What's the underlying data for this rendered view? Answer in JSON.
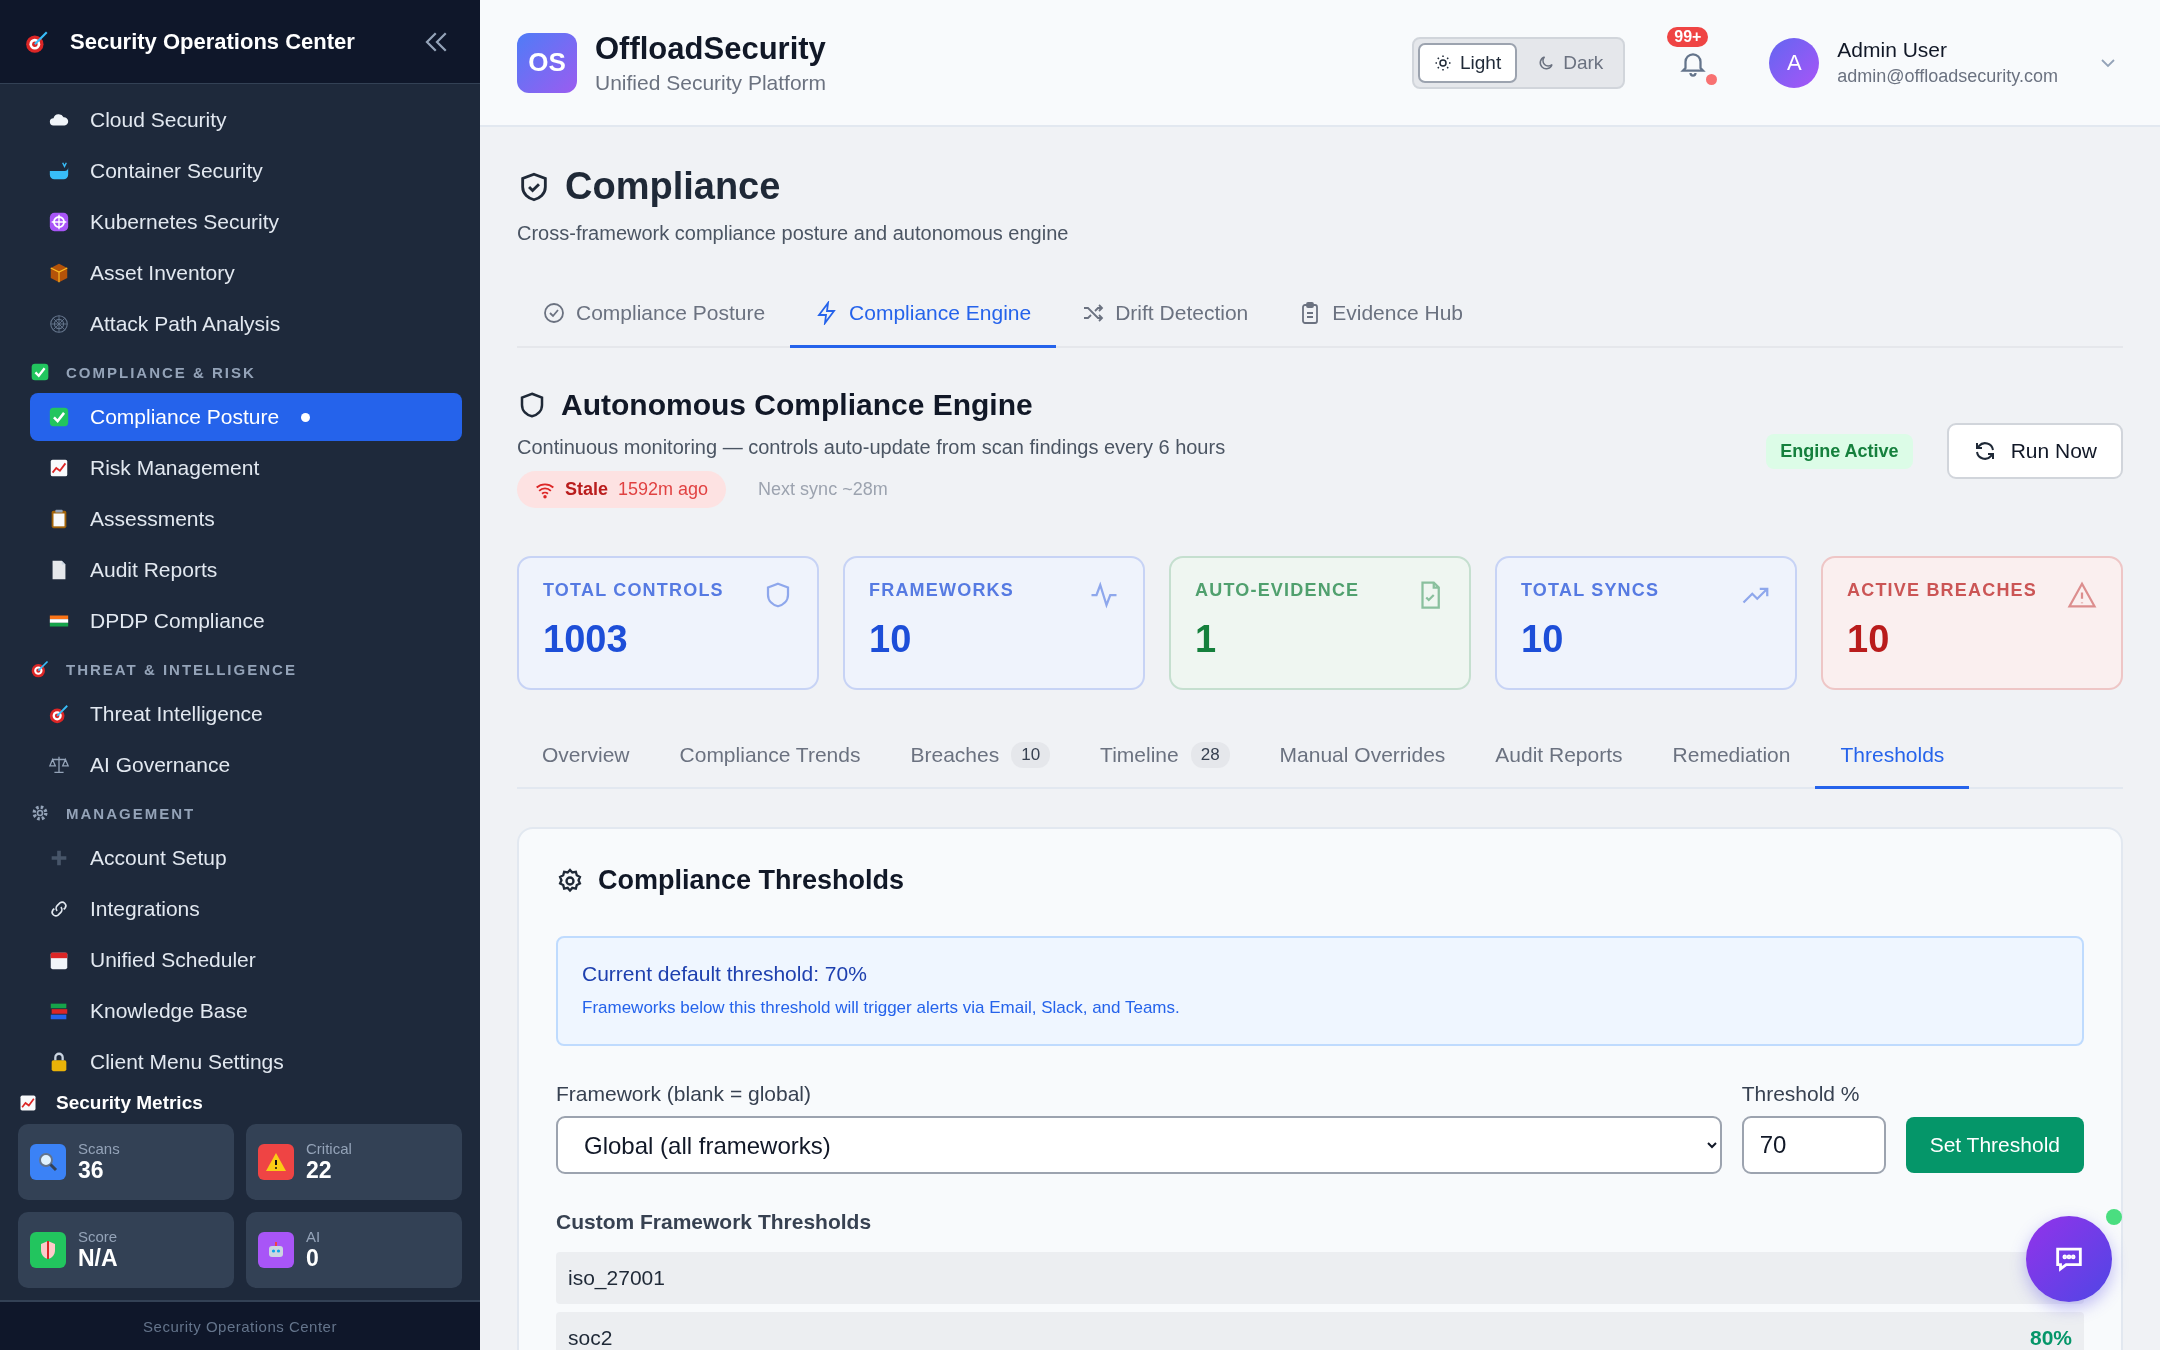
{
  "sidebar": {
    "title": "Security Operations Center",
    "nav": [
      {
        "kind": "item",
        "label": "Cloud Security",
        "selected": false
      },
      {
        "kind": "item",
        "label": "Container Security",
        "selected": false
      },
      {
        "kind": "item",
        "label": "Kubernetes Security",
        "selected": false
      },
      {
        "kind": "item",
        "label": "Asset Inventory",
        "selected": false
      },
      {
        "kind": "item",
        "label": "Attack Path Analysis",
        "selected": false
      },
      {
        "kind": "section",
        "label": "COMPLIANCE & RISK"
      },
      {
        "kind": "item",
        "label": "Compliance Posture",
        "selected": true
      },
      {
        "kind": "item",
        "label": "Risk Management",
        "selected": false
      },
      {
        "kind": "item",
        "label": "Assessments",
        "selected": false
      },
      {
        "kind": "item",
        "label": "Audit Reports",
        "selected": false
      },
      {
        "kind": "item",
        "label": "DPDP Compliance",
        "selected": false
      },
      {
        "kind": "section",
        "label": "THREAT & INTELLIGENCE"
      },
      {
        "kind": "item",
        "label": "Threat Intelligence",
        "selected": false
      },
      {
        "kind": "item",
        "label": "AI Governance",
        "selected": false
      },
      {
        "kind": "section",
        "label": "MANAGEMENT"
      },
      {
        "kind": "item",
        "label": "Account Setup",
        "selected": false
      },
      {
        "kind": "item",
        "label": "Integrations",
        "selected": false
      },
      {
        "kind": "item",
        "label": "Unified Scheduler",
        "selected": false
      },
      {
        "kind": "item",
        "label": "Knowledge Base",
        "selected": false
      },
      {
        "kind": "item",
        "label": "Client Menu Settings",
        "selected": false
      }
    ],
    "metrics_title": "Security Metrics",
    "metrics": [
      {
        "label": "Scans",
        "value": "36",
        "color": "#3b82f6"
      },
      {
        "label": "Critical",
        "value": "22",
        "color": "#ef4444"
      },
      {
        "label": "Score",
        "value": "N/A",
        "color": "#22c55e"
      },
      {
        "label": "AI",
        "value": "0",
        "color": "#a855f7"
      }
    ],
    "footer": "Security Operations Center"
  },
  "header": {
    "logo": "OS",
    "brand": "OffloadSecurity",
    "tagline": "Unified Security Platform",
    "theme": [
      {
        "label": "Light",
        "selected": true
      },
      {
        "label": "Dark",
        "selected": false
      }
    ],
    "notifications": "99+",
    "avatar": "A",
    "user_name": "Admin User",
    "user_email": "admin@offloadsecurity.com"
  },
  "page": {
    "title": "Compliance",
    "subtitle": "Cross-framework compliance posture and autonomous engine",
    "tabs": [
      {
        "label": "Compliance Posture",
        "selected": false
      },
      {
        "label": "Compliance Engine",
        "selected": true
      },
      {
        "label": "Drift Detection",
        "selected": false
      },
      {
        "label": "Evidence Hub",
        "selected": false
      }
    ]
  },
  "engine": {
    "title": "Autonomous Compliance Engine",
    "description": "Continuous monitoring — controls auto-update from scan findings every 6 hours",
    "status": "Engine Active",
    "run_button": "Run Now",
    "stale_label": "Stale",
    "stale_age": "1592m ago",
    "next_sync": "Next sync ~28m",
    "stats": [
      {
        "label": "TOTAL CONTROLS",
        "value": "1003",
        "color": "#1d4ed8"
      },
      {
        "label": "FRAMEWORKS",
        "value": "10",
        "color": "#1d4ed8"
      },
      {
        "label": "AUTO-EVIDENCE",
        "value": "1",
        "color": "#15803d"
      },
      {
        "label": "TOTAL SYNCS",
        "value": "10",
        "color": "#1d4ed8"
      },
      {
        "label": "ACTIVE BREACHES",
        "value": "10",
        "color": "#b91c1c"
      }
    ],
    "subtabs": [
      {
        "label": "Overview",
        "selected": false
      },
      {
        "label": "Compliance Trends",
        "selected": false
      },
      {
        "label": "Breaches",
        "count": "10",
        "selected": false
      },
      {
        "label": "Timeline",
        "count": "28",
        "selected": false
      },
      {
        "label": "Manual Overrides",
        "selected": false
      },
      {
        "label": "Audit Reports",
        "selected": false
      },
      {
        "label": "Remediation",
        "selected": false
      },
      {
        "label": "Thresholds",
        "selected": true
      }
    ]
  },
  "thresholds": {
    "title": "Compliance Thresholds",
    "info_heading": "Current default threshold: 70%",
    "info_text": "Frameworks below this threshold will trigger alerts via Email, Slack, and Teams.",
    "framework_label": "Framework (blank = global)",
    "framework_value": "Global (all frameworks)",
    "threshold_label": "Threshold %",
    "threshold_value": "70",
    "button": "Set Threshold",
    "custom_title": "Custom Framework Thresholds",
    "rows": [
      {
        "name": "iso_27001"
      },
      {
        "name": "soc2",
        "value": "80%"
      }
    ]
  }
}
